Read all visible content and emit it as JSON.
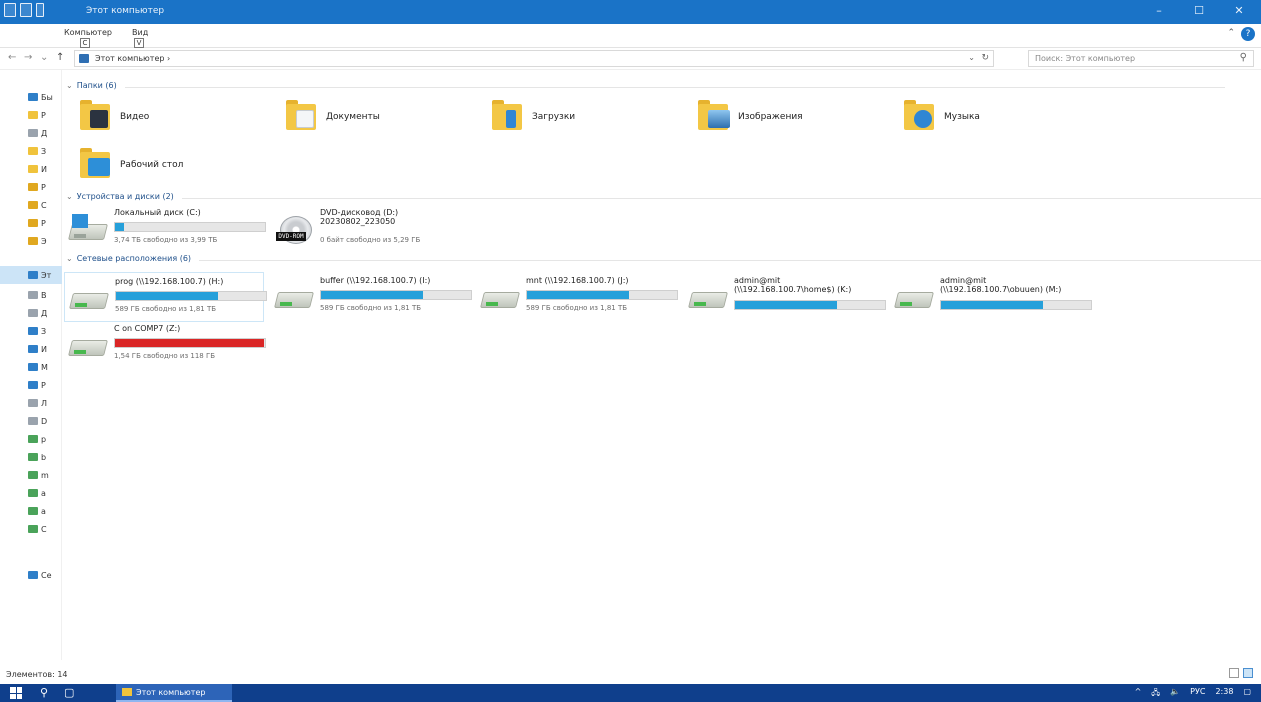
{
  "window": {
    "title": "Этот компьютер",
    "buttons": {
      "minimize": "–",
      "maximize": "☐",
      "close": "✕"
    }
  },
  "ribbon": {
    "tabs": [
      {
        "label": "Компьютер",
        "keytip": "C"
      },
      {
        "label": "Вид",
        "keytip": "V"
      }
    ],
    "collapse": "⌃",
    "help": "?"
  },
  "address": {
    "path": "Этот компьютер  ›",
    "search_placeholder": "Поиск: Этот компьютер",
    "nav": {
      "back": "←",
      "forward": "→",
      "recent": "⌄",
      "up": "↑"
    },
    "dropdown": "⌄",
    "refresh": "↻",
    "search_icon": "⚲"
  },
  "sidebar": {
    "items": [
      {
        "label": "Бы",
        "icon": "star-icon"
      },
      {
        "label": "Р",
        "icon": "folder-icon"
      },
      {
        "label": "Д",
        "icon": "folder-icon"
      },
      {
        "label": "З",
        "icon": "folder-icon"
      },
      {
        "label": "И",
        "icon": "folder-icon"
      },
      {
        "label": "Р",
        "icon": "folder-icon"
      },
      {
        "label": "С",
        "icon": "folder-icon"
      },
      {
        "label": "Р",
        "icon": "folder-icon"
      },
      {
        "label": "Э",
        "icon": "folder-icon"
      },
      {
        "label": "Эт",
        "icon": "computer-icon"
      },
      {
        "label": "В",
        "icon": "video-icon"
      },
      {
        "label": "Д",
        "icon": "documents-icon"
      },
      {
        "label": "З",
        "icon": "downloads-icon"
      },
      {
        "label": "И",
        "icon": "images-icon"
      },
      {
        "label": "М",
        "icon": "music-icon"
      },
      {
        "label": "Р",
        "icon": "desktop-icon"
      },
      {
        "label": "Л",
        "icon": "local-disk-icon"
      },
      {
        "label": "D",
        "icon": "dvd-icon"
      },
      {
        "label": "p",
        "icon": "network-drive-icon"
      },
      {
        "label": "b",
        "icon": "network-drive-icon"
      },
      {
        "label": "m",
        "icon": "network-drive-icon"
      },
      {
        "label": "a",
        "icon": "network-drive-icon"
      },
      {
        "label": "a",
        "icon": "network-drive-icon"
      },
      {
        "label": "C",
        "icon": "network-drive-icon"
      },
      {
        "label": "Се",
        "icon": "network-icon"
      }
    ]
  },
  "groups": {
    "folders": "Папки (6)",
    "devices": "Устройства и диски (2)",
    "network": "Сетевые расположения (6)"
  },
  "folders": [
    {
      "label": "Видео",
      "icon": "video-folder-icon"
    },
    {
      "label": "Документы",
      "icon": "documents-folder-icon"
    },
    {
      "label": "Загрузки",
      "icon": "downloads-folder-icon"
    },
    {
      "label": "Изображения",
      "icon": "images-folder-icon"
    },
    {
      "label": "Музыка",
      "icon": "music-folder-icon"
    },
    {
      "label": "Рабочий стол",
      "icon": "desktop-folder-icon"
    }
  ],
  "devices": [
    {
      "name": "Локальный диск (C:)",
      "free": "3,74 ТБ свободно из 3,99 ТБ",
      "fill": 0.06,
      "icon": "local-disk-icon"
    },
    {
      "name": "DVD-дисковод (D:)",
      "sub": "20230802_223050",
      "free": "0 байт свободно из 5,29 ГБ",
      "badge": "DVD-ROM",
      "icon": "dvd-drive-icon"
    }
  ],
  "network_drives": [
    {
      "name": "prog (\\\\192.168.100.7) (H:)",
      "free": "589 ГБ свободно из 1,81 ТБ",
      "fill": 0.68
    },
    {
      "name": "buffer (\\\\192.168.100.7) (I:)",
      "free": "589 ГБ свободно из 1,81 ТБ",
      "fill": 0.68
    },
    {
      "name": "mnt (\\\\192.168.100.7) (J:)",
      "free": "589 ГБ свободно из 1,81 ТБ",
      "fill": 0.68
    },
    {
      "name": "admin@mit",
      "name2": "(\\\\192.168.100.7\\home$) (K:)",
      "free": "",
      "fill": 0.68
    },
    {
      "name": "admin@mit",
      "name2": "(\\\\192.168.100.7\\obuuen) (M:)",
      "free": "",
      "fill": 0.68
    },
    {
      "name": "C on COMP7 (Z:)",
      "free": "1,54 ГБ свободно из 118 ГБ",
      "fill": 0.99,
      "full": true
    }
  ],
  "status": {
    "count": "Элементов: 14"
  },
  "taskbar": {
    "app_label": "Этот компьютер",
    "search_icon": "⚲",
    "taskview_icon": "▢",
    "tray": {
      "chevron": "^",
      "net": "🖧",
      "vol": "🔈",
      "lang": "РУС",
      "time": "2:38",
      "notify": "▢"
    }
  },
  "colors": {
    "accent": "#1a73c7",
    "taskbar": "#0f3f8c",
    "bar_fill": "#26a0da",
    "bar_full": "#da2626"
  }
}
